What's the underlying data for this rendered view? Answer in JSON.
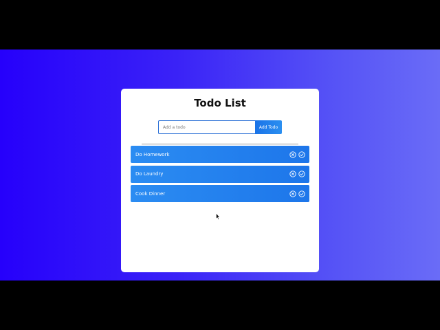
{
  "app": {
    "title": "Todo List"
  },
  "form": {
    "input_value": "",
    "input_placeholder": "Add a todo",
    "add_button_label": "Add Todo"
  },
  "todos": [
    {
      "text": "Do Homework",
      "delete_icon": "x-circle-icon",
      "complete_icon": "check-circle-icon"
    },
    {
      "text": "Do Laundry",
      "delete_icon": "x-circle-icon",
      "complete_icon": "check-circle-icon"
    },
    {
      "text": "Cook Dinner",
      "delete_icon": "x-circle-icon",
      "complete_icon": "check-circle-icon"
    }
  ],
  "colors": {
    "background_start": "#2600fb",
    "background_end": "#6a6cf7",
    "accent": "#1d76ea",
    "card": "#ffffff",
    "letterbox": "#000000"
  }
}
